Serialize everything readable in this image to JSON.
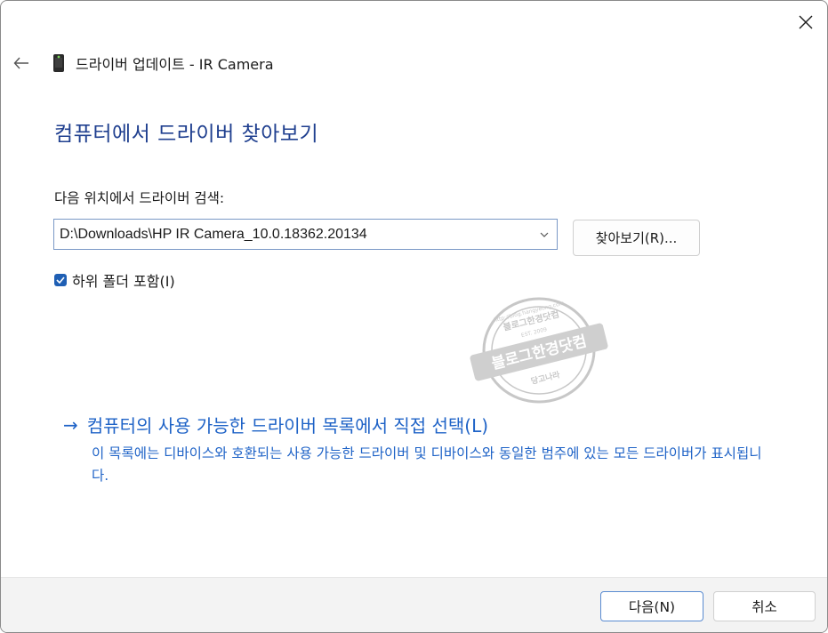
{
  "window": {
    "title": "드라이버 업데이트 - IR Camera",
    "close_icon": "close-icon",
    "back_icon": "back-arrow-icon",
    "device_icon": "camera-device-icon"
  },
  "main": {
    "heading": "컴퓨터에서 드라이버 찾아보기",
    "search_label": "다음 위치에서 드라이버 검색:",
    "path_value": "D:\\Downloads\\HP IR Camera_10.0.18362.20134",
    "browse_label": "찾아보기(R)...",
    "include_subfolders_label": "하위 폴더 포함(I)",
    "include_subfolders_checked": true
  },
  "pick_option": {
    "title": "컴퓨터의 사용 가능한 드라이버 목록에서 직접 선택(L)",
    "description": "이 목록에는 디바이스와 호환되는 사용 가능한 드라이버 및 디바이스와 동일한 범주에 있는 모든 드라이버가 표시됩니다."
  },
  "watermark": {
    "text_center": "블로그한경닷컴",
    "text_top": "블로그한경닷컴",
    "url": "http://blog.hangyeong.com",
    "est": "EST. 2009",
    "motto": "당고나라"
  },
  "footer": {
    "next_label": "다음(N)",
    "cancel_label": "취소"
  },
  "colors": {
    "heading": "#1f3f8f",
    "link": "#1f63c7",
    "accent": "#1f5fb4"
  }
}
